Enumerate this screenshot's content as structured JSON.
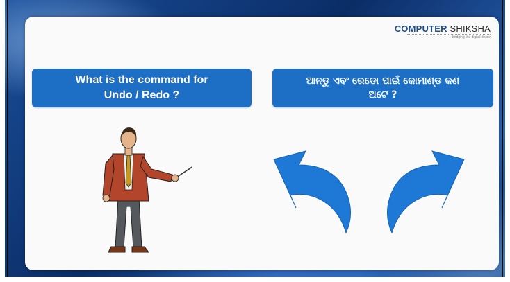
{
  "logo": {
    "name_part1": "COMPUTER",
    "name_part2": " SHIKSHA",
    "tagline": "bridging the digital divide"
  },
  "question_english": {
    "line1": "What is the command for",
    "line2": "Undo / Redo ?"
  },
  "question_odia": {
    "line1": "ଆନ୍ଡୁ ଏବଂ ରେଡୋ ପାଇଁ କୋମାଣ୍ଡ କଣ",
    "line2": "ଅଟେ ?"
  },
  "colors": {
    "box_blue": "#1d6ec5",
    "arrow_blue": "#1e78d6",
    "logo_blue": "#1f4e8a"
  },
  "icons": {
    "undo": "undo-arrow-icon",
    "redo": "redo-arrow-icon",
    "illustration": "teacher-with-pointer"
  }
}
